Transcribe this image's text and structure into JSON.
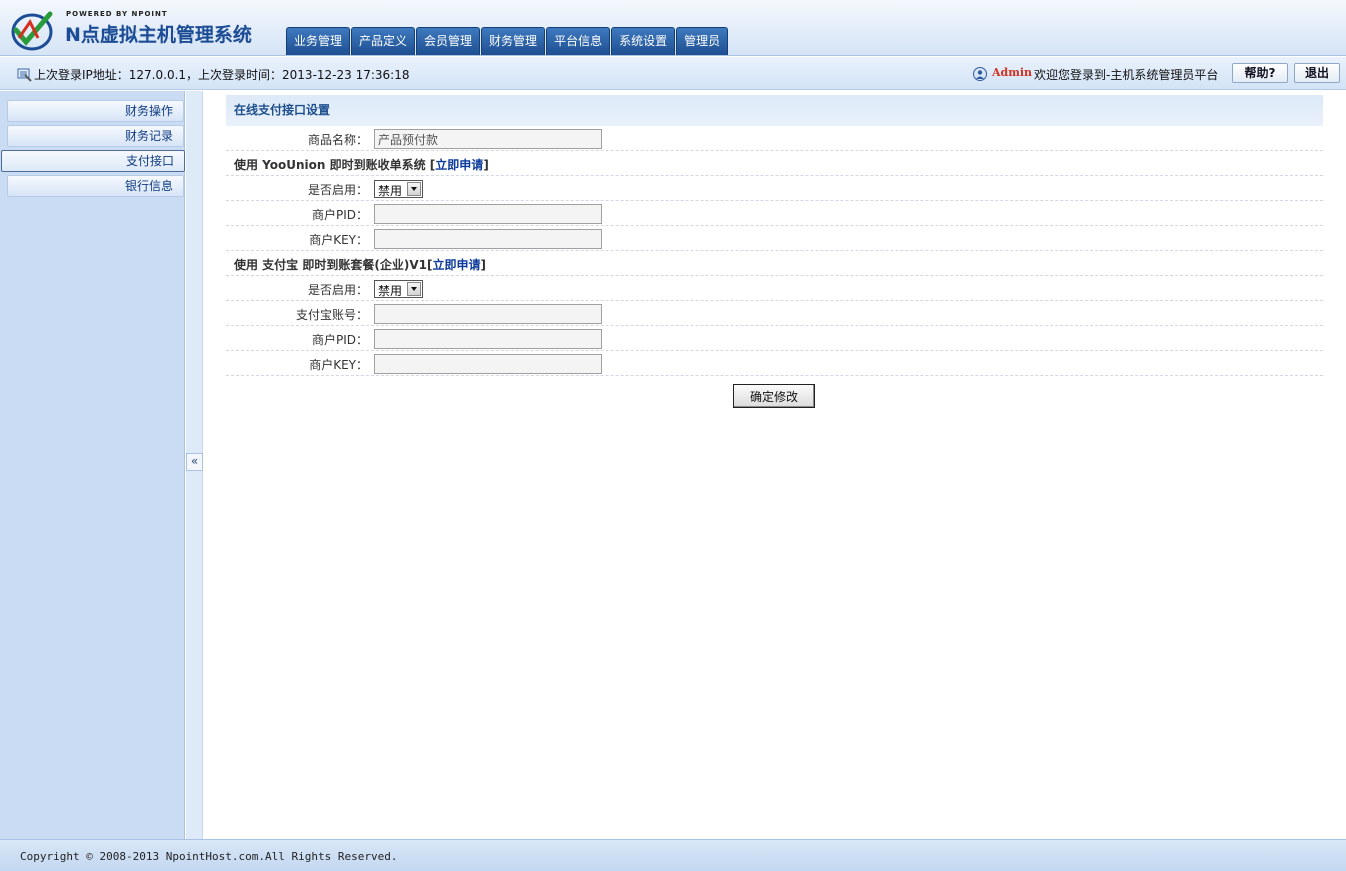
{
  "logo": {
    "powered": "POWERED BY NPOINT",
    "title": "N点虚拟主机管理系统"
  },
  "nav": {
    "tabs": [
      "业务管理",
      "产品定义",
      "会员管理",
      "财务管理",
      "平台信息",
      "系统设置",
      "管理员"
    ]
  },
  "infobar": {
    "login_info": "上次登录IP地址：127.0.0.1，上次登录时间：2013-12-23 17:36:18",
    "admin_name": "Admin",
    "welcome": "欢迎您登录到-主机系统管理员平台",
    "help_label": "帮助?",
    "logout_label": "退出"
  },
  "sidebar": {
    "items": [
      "财务操作",
      "财务记录",
      "支付接口",
      "银行信息"
    ],
    "active": "支付接口",
    "collapse_label": "«"
  },
  "main": {
    "section_title": "在线支付接口设置",
    "product_name_label": "商品名称：",
    "product_name_value": "产品预付款",
    "yoounion": {
      "heading_prefix": "使用 YooUnion 即时到账收单系统 [",
      "apply_link": "立即申请",
      "heading_suffix": "]",
      "enable_label": "是否启用：",
      "enable_value": "禁用",
      "pid_label": "商户PID：",
      "key_label": "商户KEY："
    },
    "alipay": {
      "heading_prefix": "使用 支付宝 即时到账套餐(企业)V1[",
      "apply_link": "立即申请",
      "heading_suffix": "]",
      "enable_label": "是否启用：",
      "enable_value": "禁用",
      "account_label": "支付宝账号：",
      "pid_label": "商户PID：",
      "key_label": "商户KEY："
    },
    "submit_label": "确定修改"
  },
  "footer": {
    "copyright": "Copyright © 2008-2013 NpointHost.com.All Rights Reserved."
  }
}
